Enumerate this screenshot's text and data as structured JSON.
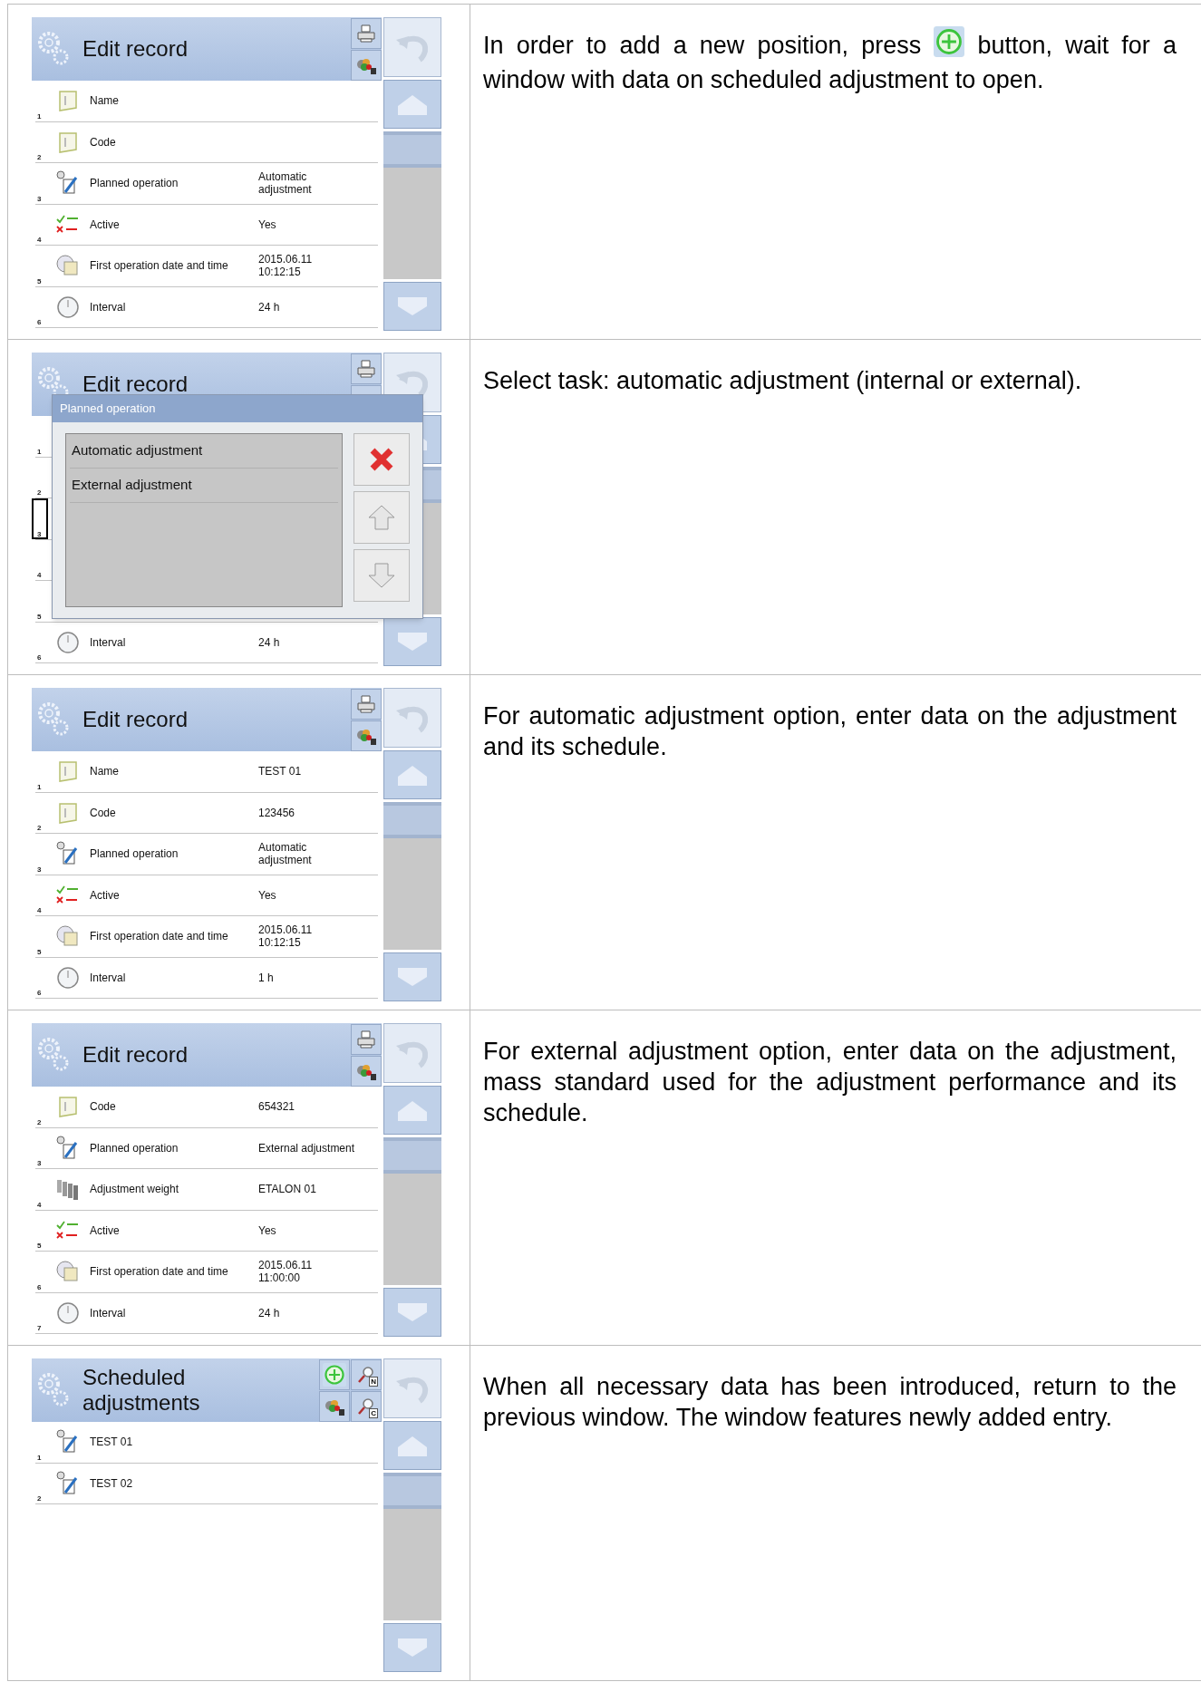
{
  "steps": [
    {
      "screen": {
        "title": "Edit record",
        "header_buttons": [
          {
            "kind": "print"
          },
          {
            "kind": "export"
          }
        ],
        "rows": [
          {
            "number": "1",
            "kind": "name",
            "label": "Name"
          },
          {
            "number": "2",
            "kind": "code",
            "label": "Code"
          },
          {
            "number": "3",
            "kind": "operation",
            "label": "Planned operation",
            "value": "Automatic adjustment"
          },
          {
            "number": "4",
            "kind": "active",
            "label": "Active",
            "value": "Yes"
          },
          {
            "number": "5",
            "kind": "calendar",
            "label": "First operation date and time",
            "value": "2015.06.11 10:12:15"
          },
          {
            "number": "6",
            "kind": "clock",
            "label": "Interval",
            "value": "24 h"
          }
        ]
      },
      "description": [
        {
          "kind": "text",
          "text": "In order to add a new position, press"
        },
        {
          "kind": "add-icon"
        },
        {
          "kind": "text",
          "text": "button, wait for a window with data on scheduled adjustment to open."
        }
      ]
    },
    {
      "screen": {
        "title": "Edit record",
        "header_buttons": [
          {
            "kind": "print"
          },
          {
            "kind": "export"
          }
        ],
        "rows": [
          {
            "number": "1",
            "selected": false
          },
          {
            "number": "2",
            "selected": false
          },
          {
            "number": "3",
            "selected": true
          },
          {
            "number": "4",
            "selected": false
          },
          {
            "number": "5",
            "selected": false
          },
          {
            "number": "6",
            "kind": "clock",
            "label": "Interval",
            "value": "24 h",
            "selected": false
          }
        ],
        "dialog": {
          "title": "Planned operation",
          "options": [
            "Automatic adjustment",
            "External adjustment"
          ],
          "buttons": [
            {
              "kind": "cancel"
            },
            {
              "kind": "up"
            },
            {
              "kind": "down"
            }
          ]
        }
      },
      "description": [
        {
          "kind": "text",
          "text": "Select task: automatic adjustment (internal or external)."
        }
      ]
    },
    {
      "screen": {
        "title": "Edit record",
        "header_buttons": [
          {
            "kind": "print"
          },
          {
            "kind": "export"
          }
        ],
        "rows": [
          {
            "number": "1",
            "kind": "name",
            "label": "Name",
            "value": "TEST  01"
          },
          {
            "number": "2",
            "kind": "code",
            "label": "Code",
            "value": "123456"
          },
          {
            "number": "3",
            "kind": "operation",
            "label": "Planned operation",
            "value": "Automatic adjustment"
          },
          {
            "number": "4",
            "kind": "active",
            "label": "Active",
            "value": "Yes"
          },
          {
            "number": "5",
            "kind": "calendar",
            "label": "First operation date and time",
            "value": "2015.06.11 10:12:15"
          },
          {
            "number": "6",
            "kind": "clock",
            "label": "Interval",
            "value": "1 h"
          }
        ]
      },
      "description": [
        {
          "kind": "text",
          "text": "For automatic adjustment option, enter data on the adjustment and its schedule."
        }
      ]
    },
    {
      "screen": {
        "title": "Edit record",
        "header_buttons": [
          {
            "kind": "print"
          },
          {
            "kind": "export"
          }
        ],
        "rows": [
          {
            "number": "2",
            "kind": "code",
            "label": "Code",
            "value": "654321"
          },
          {
            "number": "3",
            "kind": "operation",
            "label": "Planned operation",
            "value": "External adjustment"
          },
          {
            "number": "4",
            "kind": "weights",
            "label": "Adjustment weight",
            "value": "ETALON 01"
          },
          {
            "number": "5",
            "kind": "active",
            "label": "Active",
            "value": "Yes"
          },
          {
            "number": "6",
            "kind": "calendar",
            "label": "First operation date and time",
            "value": "2015.06.11 11:00:00"
          },
          {
            "number": "7",
            "kind": "clock",
            "label": "Interval",
            "value": "24 h"
          }
        ]
      },
      "description": [
        {
          "kind": "text",
          "text": "For external adjustment option, enter data on the adjustment, mass standard used for the adjustment performance and its schedule."
        }
      ]
    },
    {
      "screen": {
        "title": "Scheduled adjustments",
        "header_buttons": [
          {
            "kind": "add"
          },
          {
            "kind": "search",
            "letter": "N"
          },
          {
            "kind": "export"
          },
          {
            "kind": "search",
            "letter": "C"
          }
        ],
        "rows": [
          {
            "number": "1",
            "kind": "operation",
            "label": "TEST 01"
          },
          {
            "number": "2",
            "kind": "operation",
            "label": "TEST 02"
          }
        ]
      },
      "description": [
        {
          "kind": "text",
          "text": "When all necessary data has been introduced, return to the previous window. The window features newly added entry."
        }
      ]
    }
  ]
}
